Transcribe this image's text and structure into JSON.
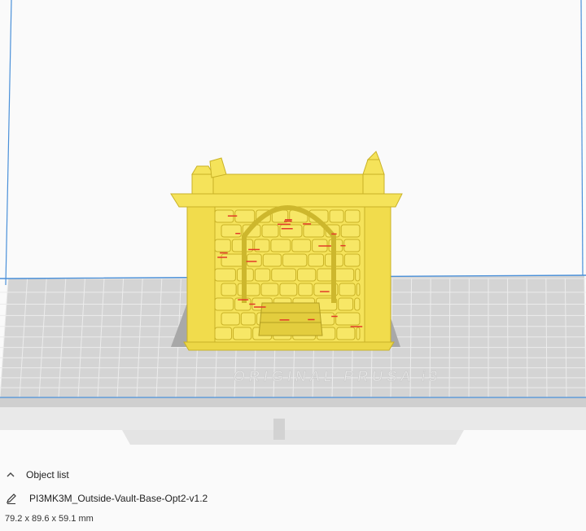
{
  "viewport": {
    "watermark_text": "ORIGINAL PRUSA i3",
    "colors": {
      "background": "#fafafa",
      "bed_top": "#d6d6d6",
      "bed_grid": "#ececec",
      "bed_front": "#e6e6e6",
      "build_volume_line": "#4a90d9",
      "model_fill": "#f5e35a",
      "model_dark": "#d8c230",
      "overhang": "#e23a2a"
    }
  },
  "object_list": {
    "header_label": "Object list",
    "header_icon": "chevron-up-icon",
    "object_icon": "pencil-icon",
    "object_name": "PI3MK3M_Outside-Vault-Base-Opt2-v1.2",
    "dimensions": "79.2 x 89.6 x 59.1 mm"
  }
}
